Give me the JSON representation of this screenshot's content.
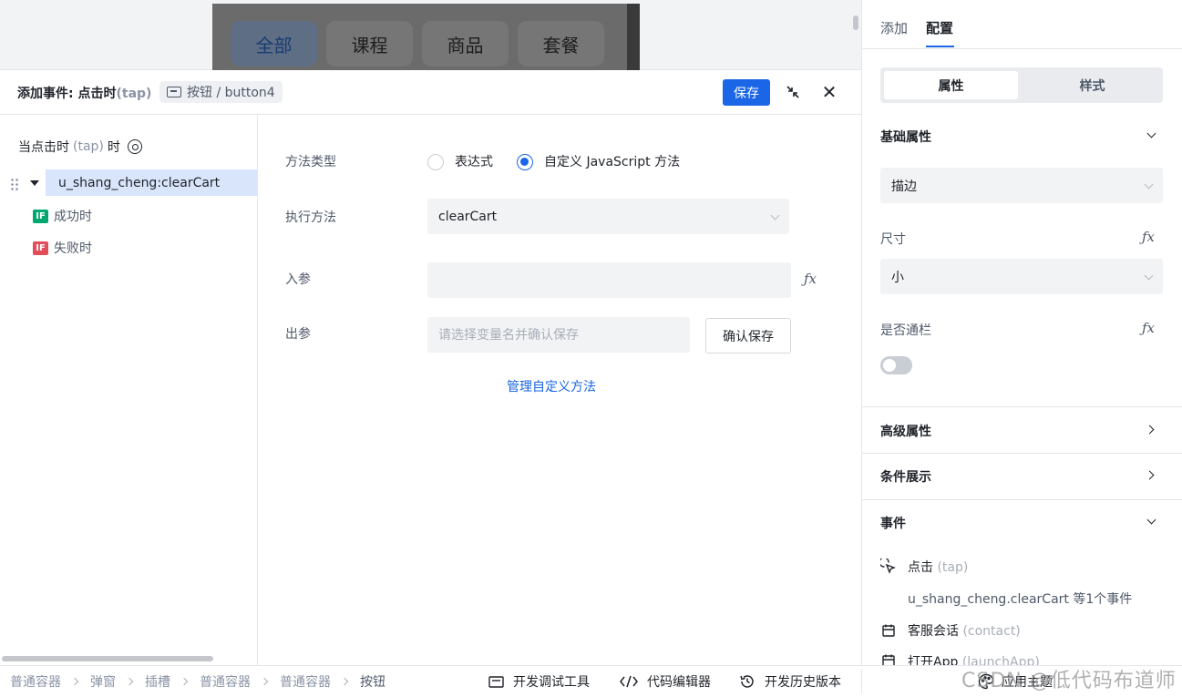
{
  "preview": {
    "tabs": [
      "全部",
      "课程",
      "商品",
      "套餐"
    ]
  },
  "event_header": {
    "title": "添加事件: 点击时",
    "title_suffix": "(tap)",
    "component_chip": "按钮 / button4",
    "save_label": "保存"
  },
  "tree": {
    "head_text": "当点击时",
    "head_muted": "(tap)",
    "head_tail": "时",
    "node_label": "u_shang_cheng:clearCart",
    "branches": [
      {
        "badge": "IF",
        "label": "成功时",
        "color": "#00a870"
      },
      {
        "badge": "IF",
        "label": "失败时",
        "color": "#e34d59"
      }
    ]
  },
  "form": {
    "method_type_label": "方法类型",
    "radio_expression": "表达式",
    "radio_custom_js": "自定义 JavaScript 方法",
    "exec_method_label": "执行方法",
    "exec_method_value": "clearCart",
    "input_param_label": "入参",
    "output_param_label": "出参",
    "output_param_placeholder": "请选择变量名并确认保存",
    "confirm_save_label": "确认保存",
    "manage_link": "管理自定义方法",
    "fx_symbol": "ƒx"
  },
  "right_panel": {
    "tab_add": "添加",
    "tab_config": "配置",
    "seg_props": "属性",
    "seg_style": "样式",
    "basic_props_title": "基础属性",
    "border_select": "描边",
    "size_label": "尺寸",
    "size_select": "小",
    "fullwidth_label": "是否通栏",
    "advanced_title": "高级属性",
    "conditional_title": "条件展示",
    "events_title": "事件",
    "events": [
      {
        "label": "点击",
        "code": "(tap)"
      },
      {
        "label": "客服会话",
        "code": "(contact)"
      },
      {
        "label": "打开App",
        "code": "(launchApp)"
      }
    ],
    "tap_sub": "u_shang_cheng.clearCart 等1个事件",
    "fx_symbol": "ƒx"
  },
  "bottom_bar": {
    "breadcrumbs": [
      "普通容器",
      "弹窗",
      "插槽",
      "普通容器",
      "普通容器",
      "按钮"
    ],
    "dev_tools": "开发调试工具",
    "code_editor": "代码编辑器",
    "history": "开发历史版本",
    "theme": "应用主题"
  },
  "watermark": "CSDN @低代码布道师"
}
